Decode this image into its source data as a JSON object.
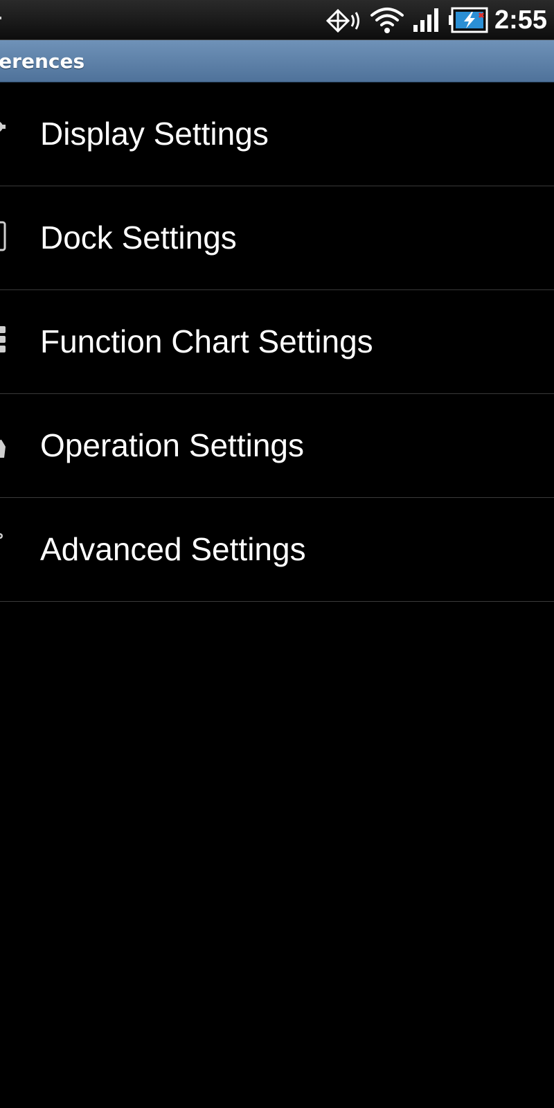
{
  "status_bar": {
    "time": "2:55",
    "icons": [
      "gps-icon",
      "wifi-icon",
      "signal-icon",
      "battery-charging-icon"
    ]
  },
  "title_bar": {
    "title": "ferences"
  },
  "settings": {
    "items": [
      {
        "label": "Display Settings",
        "icon": "gear-icon"
      },
      {
        "label": "Dock Settings",
        "icon": "dock-icon"
      },
      {
        "label": "Function Chart Settings",
        "icon": "grid-icon"
      },
      {
        "label": "Operation Settings",
        "icon": "hand-icon"
      },
      {
        "label": "Advanced Settings",
        "icon": "gear-icon"
      }
    ]
  },
  "colors": {
    "title_bar": "#5b7ea6",
    "background": "#000000",
    "divider": "#3a3a3a",
    "text": "#ffffff"
  }
}
